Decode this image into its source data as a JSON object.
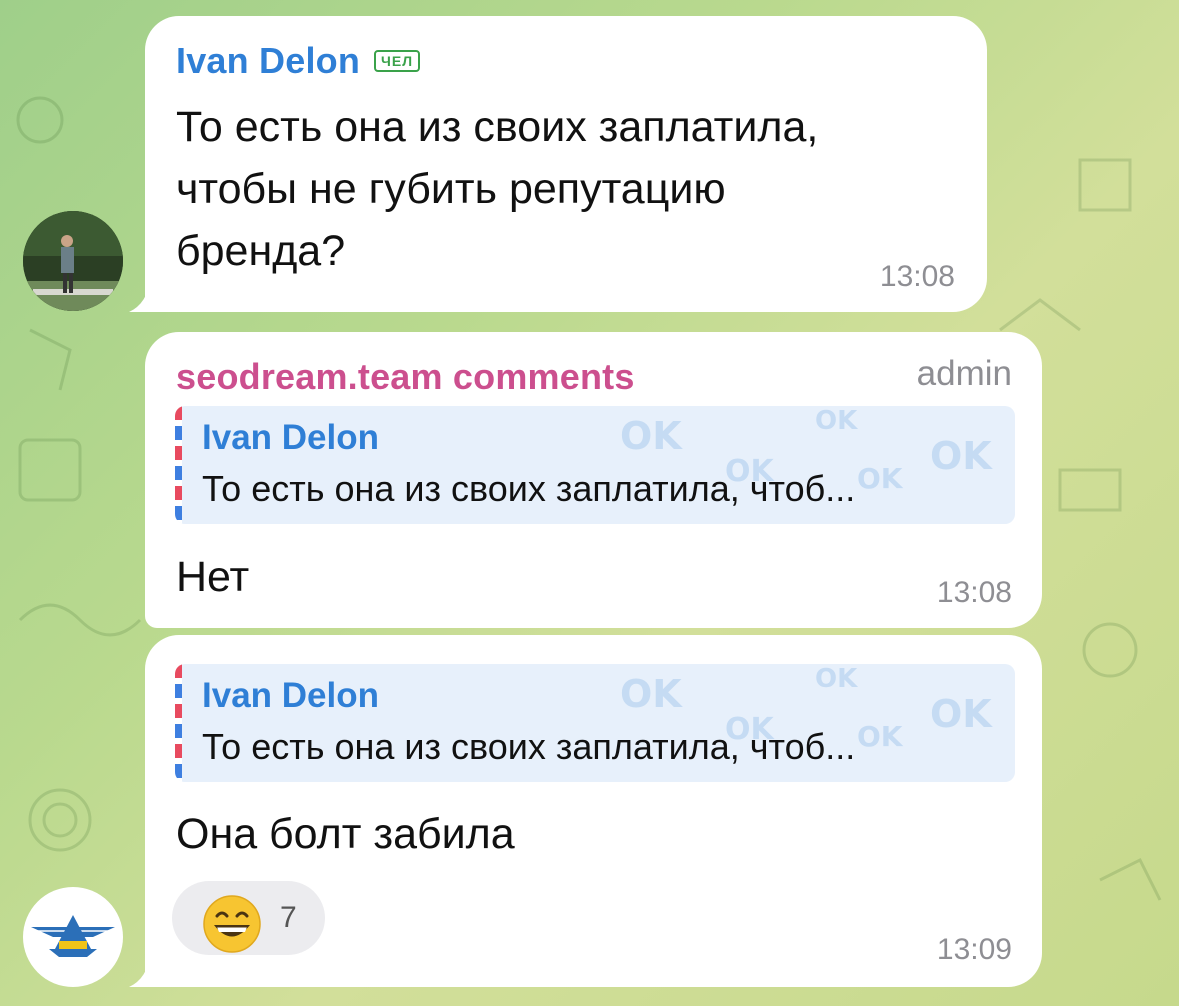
{
  "messages": [
    {
      "sender": "Ivan Delon",
      "sender_tag": "ЧЕЛ",
      "text_lines": [
        "То есть она из своих заплатила,",
        "чтобы не губить репутацию",
        "бренда?"
      ],
      "time": "13:08"
    },
    {
      "sender": "seodream.team comments",
      "sender_role": "admin",
      "reply": {
        "name": "Ivan Delon",
        "text": "То есть она из своих заплатила, чтоб..."
      },
      "text": "Нет",
      "time": "13:08"
    },
    {
      "reply": {
        "name": "Ivan Delon",
        "text": "То есть она из своих заплатила, чтоб..."
      },
      "text": "Она болт забила",
      "reaction": {
        "emoji": "grinning-face",
        "count": "7"
      },
      "time": "13:09"
    }
  ],
  "reply_watermark": "OK",
  "colors": {
    "sender_blue": "#2f7fd6",
    "sender_pink": "#cc4f8e",
    "tag_green": "#3aa24a",
    "reply_bg": "#e7f0fb",
    "time_gray": "#8e8e93"
  },
  "avatars": [
    "ivan-delon-photo",
    "sdt-logo"
  ]
}
